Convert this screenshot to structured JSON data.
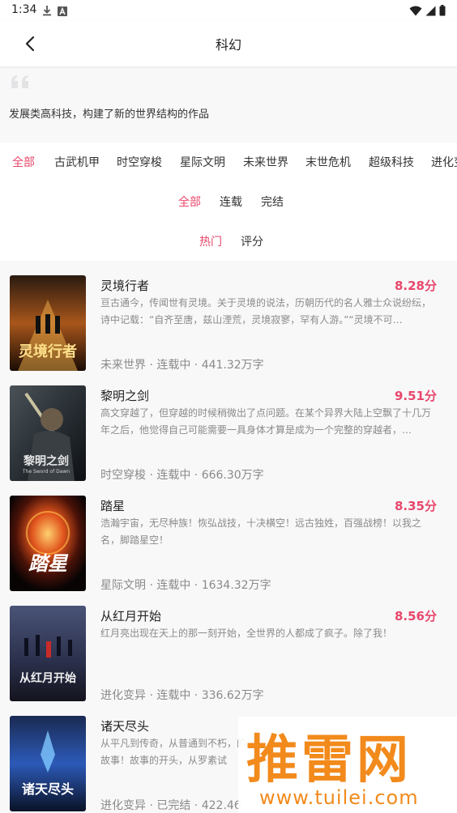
{
  "status_bar": {
    "time": "1:34",
    "icons": [
      "download-icon",
      "notification-a-icon",
      "wifi-icon",
      "signal-icon",
      "battery-icon"
    ]
  },
  "header": {
    "title": "科幻"
  },
  "description": "发展类高科技，构建了新的世界结构的作品",
  "category_filters": [
    {
      "label": "全部",
      "active": true
    },
    {
      "label": "古武机甲",
      "active": false
    },
    {
      "label": "时空穿梭",
      "active": false
    },
    {
      "label": "星际文明",
      "active": false
    },
    {
      "label": "未来世界",
      "active": false
    },
    {
      "label": "末世危机",
      "active": false
    },
    {
      "label": "超级科技",
      "active": false
    },
    {
      "label": "进化变异",
      "active": false
    }
  ],
  "status_filters": [
    {
      "label": "全部",
      "active": true
    },
    {
      "label": "连载",
      "active": false
    },
    {
      "label": "完结",
      "active": false
    }
  ],
  "sort_filters": [
    {
      "label": "热门",
      "active": true
    },
    {
      "label": "评分",
      "active": false
    }
  ],
  "books": [
    {
      "title": "灵境行者",
      "score": "8.28分",
      "desc": "亘古通今，传闻世有灵境。关于灵境的说法，历朝历代的名人雅士众说纷纭，诗中记载：“自齐至唐，兹山湮荒，灵境寂寥，罕有人游。”“灵境不可…",
      "meta": "未来世界 · 连载中 · 441.32万字",
      "cover_text": "灵境行者"
    },
    {
      "title": "黎明之剑",
      "score": "9.51分",
      "desc": "高文穿越了，但穿越的时候稍微出了点问题。在某个异界大陆上空飘了十几万年之后，他觉得自己可能需要一具身体才算是成为一个完整的穿越者，…",
      "meta": "时空穿梭 · 连载中 · 666.30万字",
      "cover_text": "黎明之剑",
      "cover_sub": "The Sword of Dawn"
    },
    {
      "title": "踏星",
      "score": "8.35分",
      "desc": "浩瀚宇宙，无尽种族！恢弘战技，十决横空！远古独姓，百强战榜！以我之名，脚踏星空！",
      "meta": "星际文明 · 连载中 · 1634.32万字",
      "cover_text": "踏星"
    },
    {
      "title": "从红月开始",
      "score": "8.56分",
      "desc": "红月亮出现在天上的那一刻开始，全世界的人都成了疯子。除了我！",
      "meta": "进化变异 · 连载中 · 336.62万字",
      "cover_text": "从红月开始"
    },
    {
      "title": "诸天尽头",
      "score": "",
      "desc": "从平凡到传奇，从普通到不朽，的故事！故事的开头，从罗素试",
      "meta": "进化变异 · 已完结 · 422.46",
      "cover_text": "诸天尽头"
    }
  ],
  "watermark": {
    "main": "推雷网",
    "url": "www.tuilei.com"
  },
  "colors": {
    "accent": "#e8476b",
    "watermark": "#f28a1c",
    "muted": "#8a8a8a"
  }
}
